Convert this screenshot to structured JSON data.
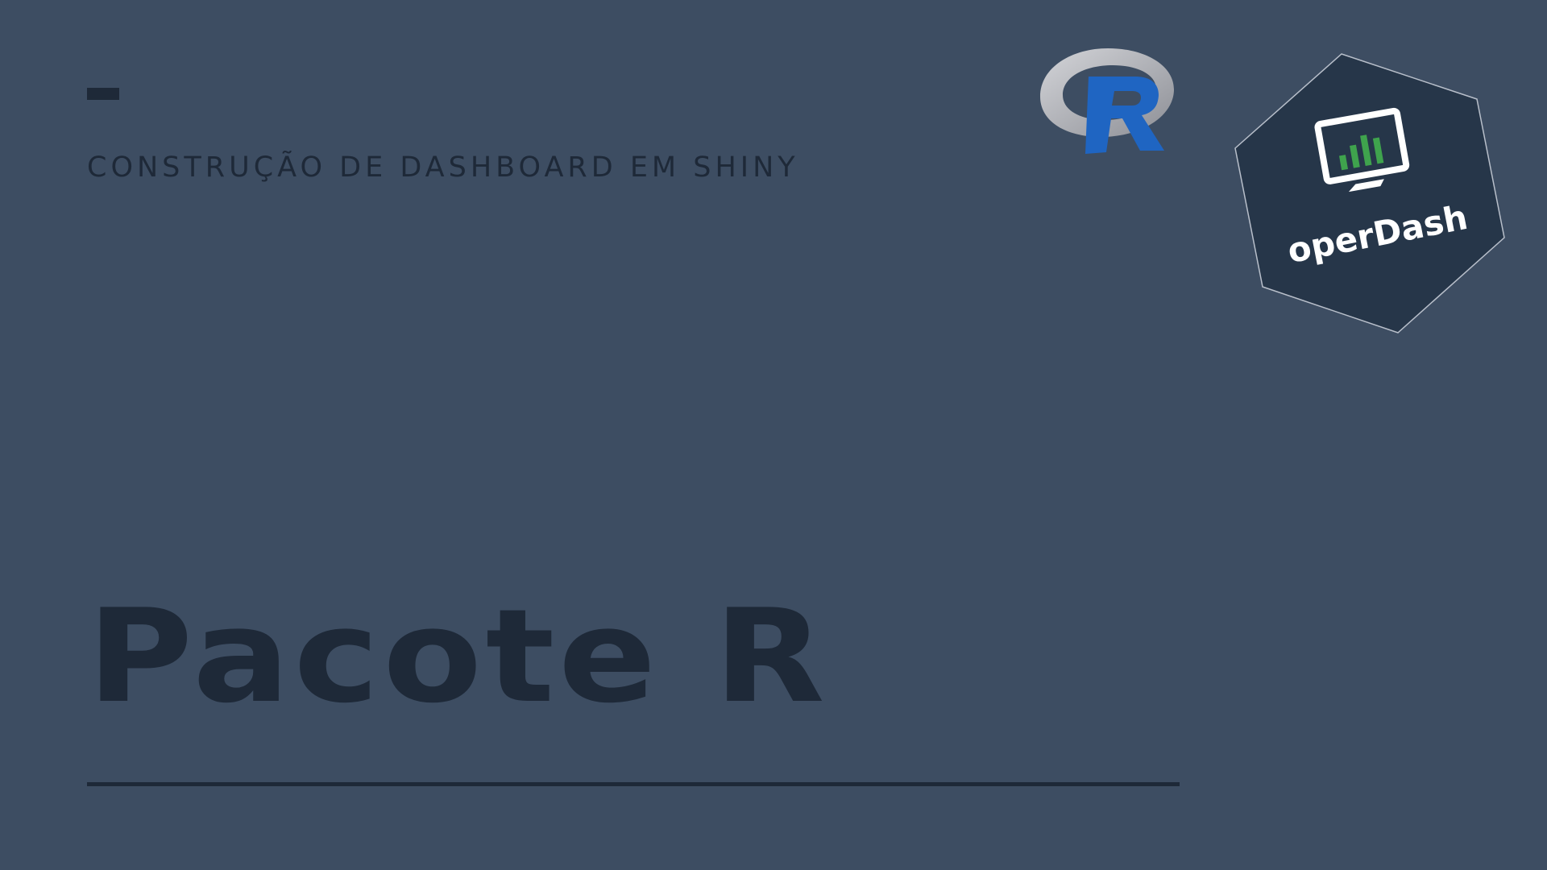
{
  "slide": {
    "subtitle": "CONSTRUÇÃO DE DASHBOARD EM SHINY",
    "title": "Pacote R"
  },
  "logos": {
    "r_logo": {
      "icon": "r-language-logo-icon",
      "letter": "R"
    },
    "hex_logo": {
      "icon": "operdash-hex-logo-icon",
      "text": "operDash"
    }
  },
  "colors": {
    "background": "#3d4d62",
    "text_dark": "#1e2938",
    "hex_fill": "#263649",
    "r_blue": "#1f65c2",
    "chart_green": "#3fa34d"
  }
}
